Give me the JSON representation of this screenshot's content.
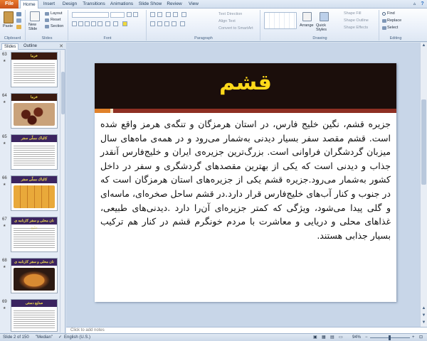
{
  "tabs": {
    "file": "File",
    "items": [
      "Home",
      "Insert",
      "Design",
      "Transitions",
      "Animations",
      "Slide Show",
      "Review",
      "View"
    ]
  },
  "ribbon": {
    "clipboard": {
      "paste": "Paste",
      "label": "Clipboard"
    },
    "slides": {
      "new_slide": "New Slide",
      "layout": "Layout",
      "reset": "Reset",
      "section": "Section",
      "label": "Slides"
    },
    "font": {
      "label": "Font"
    },
    "paragraph": {
      "text_direction": "Text Direction",
      "align_text": "Align Text",
      "convert_smartart": "Convert to SmartArt",
      "label": "Paragraph"
    },
    "drawing": {
      "arrange": "Arrange",
      "quick_styles": "Quick Styles",
      "shape_fill": "Shape Fill",
      "shape_outline": "Shape Outline",
      "shape_effects": "Shape Effects",
      "label": "Drawing"
    },
    "editing": {
      "find": "Find",
      "replace": "Replace",
      "select": "Select",
      "label": "Editing"
    }
  },
  "panel": {
    "tab_slides": "Slides",
    "tab_outline": "Outline",
    "thumbnails": [
      {
        "num": "63",
        "title": "خرما"
      },
      {
        "num": "64",
        "title": "خرما"
      },
      {
        "num": "65",
        "title": "کالباک مملّی سفر"
      },
      {
        "num": "66",
        "title": "کالباک مملّی سفر"
      },
      {
        "num": "67",
        "title": "نان محلی و سفر کارنامه ی خلیج"
      },
      {
        "num": "68",
        "title": "نان محلی و سفر کارنامه ی خلیج"
      },
      {
        "num": "69",
        "title": "صنایع دستی"
      }
    ]
  },
  "slide": {
    "title": "قشم",
    "body": "جزیره قشم، نگین خلیج فارس، در استان هرمزگان و تنگه‌ی هرمز واقع شده است. قشم مقصد سفر بسیار دیدنی به‌شمار می‌رود و در همه‌ی ماه‌های سال میزبان گردشگران فراوانی است. بزرگ‌ترین جزیره‌ی ایران و خلیج‌فارس آنقدر جذاب و دیدنی است که یکی از بهترین مقصدهای گردشگری و سفر در داخل کشور به‌شمار می‌رود.جزیره قشم یکی از جزیره‌های استان هرمزگان است که در جنوب و کنار آب‌های خلیج‌فارس قرار دارد.در قشم ساحل صخره‌ای، ماسه‌ای و گلی پیدا می‌شود، ویژگی که کمتر جزیره‌ای آن‌را دارد .دیدنی‌های طبیعی، غذاهای محلی و دریایی و معاشرت با مردم خونگرم قشم در کنار هم ترکیب بسیار جذابی هستند."
  },
  "notes": {
    "placeholder": "Click to add notes"
  },
  "status": {
    "slide_info": "Slide 2 of 150",
    "theme": "\"Median\"",
    "language": "English (U.S.)",
    "zoom": "94%",
    "zoom_fraction": 0.48
  },
  "colors": {
    "title_bg": "#1b0e0b",
    "title_text": "#ffd91a",
    "accent_red": "#8e2f23",
    "accent_orange": "#e0812a",
    "file_tab": "#d4601f"
  }
}
